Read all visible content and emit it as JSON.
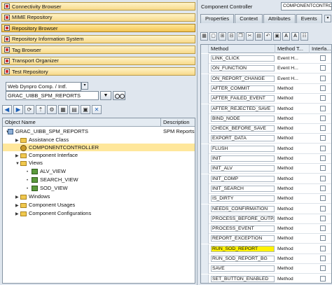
{
  "left": {
    "nav": [
      {
        "label": "Connectivity Browser",
        "active": false
      },
      {
        "label": "MIME Repository",
        "active": false
      },
      {
        "label": "Repository Browser",
        "active": true
      },
      {
        "label": "Repository Information System",
        "active": false
      },
      {
        "label": "Tag Browser",
        "active": false
      },
      {
        "label": "Transport Organizer",
        "active": false
      },
      {
        "label": "Test Repository",
        "active": false
      }
    ],
    "object_type": "Web Dynpro Comp. / Intf.",
    "object_name": "GRAC_UIBB_SPM_REPORTS",
    "f4_label": "▼",
    "toolbar_icons": [
      "back-icon",
      "forward-icon",
      "refresh-icon",
      "hierarchy-up-icon",
      "activate-icon",
      "collapse-icon",
      "expand-icon",
      "save-icon",
      "close-icon"
    ],
    "tree": {
      "col_object": "Object Name",
      "col_desc": "Description",
      "rows": [
        {
          "label": "GRAC_UIBB_SPM_REPORTS",
          "desc": "SPM Reports"
        },
        {
          "label": "Assistance Class"
        },
        {
          "label": "COMPONENTCONTROLLER"
        },
        {
          "label": "Component Interface"
        },
        {
          "label": "Views"
        },
        {
          "label": "ALV_VIEW"
        },
        {
          "label": "SEARCH_VIEW"
        },
        {
          "label": "SOD_VIEW"
        },
        {
          "label": "Windows"
        },
        {
          "label": "Component Usages"
        },
        {
          "label": "Component Configurations"
        }
      ]
    }
  },
  "right": {
    "controller_label": "Component Controller",
    "controller_value": "COMPONENTCONTRO",
    "tabs": [
      "Properties",
      "Context",
      "Attributes",
      "Events"
    ],
    "active_tab": "Methods",
    "grid": {
      "headers": [
        "Method",
        "Method T...",
        "Interfa..."
      ],
      "rows": [
        {
          "name": "LINK_CLICK",
          "type": "Event H..."
        },
        {
          "name": "ON_FUNCTION",
          "type": "Event H..."
        },
        {
          "name": "ON_REPORT_CHANGE",
          "type": "Event H..."
        },
        {
          "name": "AFTER_COMMIT",
          "type": "Method"
        },
        {
          "name": "AFTER_FAILED_EVENT",
          "type": "Method"
        },
        {
          "name": "AFTER_REJECTED_SAVE",
          "type": "Method"
        },
        {
          "name": "BIND_NODE",
          "type": "Method"
        },
        {
          "name": "CHECK_BEFORE_SAVE",
          "type": "Method"
        },
        {
          "name": "EXPORT_DATA",
          "type": "Method"
        },
        {
          "name": "FLUSH",
          "type": "Method"
        },
        {
          "name": "INIT",
          "type": "Method"
        },
        {
          "name": "INIT_ALV",
          "type": "Method"
        },
        {
          "name": "INIT_COMP",
          "type": "Method"
        },
        {
          "name": "INIT_SEARCH",
          "type": "Method"
        },
        {
          "name": "IS_DIRTY",
          "type": "Method"
        },
        {
          "name": "NEEDS_CONFIRMATION",
          "type": "Method"
        },
        {
          "name": "PROCESS_BEFORE_OUTP...",
          "type": "Method"
        },
        {
          "name": "PROCESS_EVENT",
          "type": "Method"
        },
        {
          "name": "REPORT_EXCEPTION",
          "type": "Method"
        },
        {
          "name": "RUN_SOD_REPORT",
          "type": "Method",
          "highlight": true
        },
        {
          "name": "RUN_SOD_REPORT_BG",
          "type": "Method"
        },
        {
          "name": "SAVE",
          "type": "Method"
        },
        {
          "name": "SET_BUTTON_ENABLED",
          "type": "Method"
        }
      ]
    }
  },
  "colors": {
    "highlight": "#fff200",
    "selected_row": "#ffe79b",
    "nav_button": "#f7d98a"
  }
}
